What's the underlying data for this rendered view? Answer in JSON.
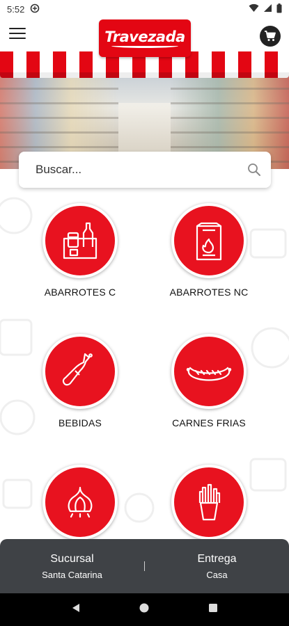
{
  "status_bar": {
    "time": "5:52"
  },
  "app": {
    "logo_text": "Travezada",
    "brand_color": "#e30613"
  },
  "search": {
    "placeholder": "Buscar..."
  },
  "categories": [
    {
      "label": "ABARROTES C",
      "icon": "canned-goods-icon"
    },
    {
      "label": "ABARROTES NC",
      "icon": "charcoal-bag-icon"
    },
    {
      "label": "BEBIDAS",
      "icon": "bottle-icon"
    },
    {
      "label": "CARNES FRIAS",
      "icon": "sausage-icon"
    },
    {
      "label": "",
      "icon": "garlic-icon"
    },
    {
      "label": "",
      "icon": "fries-icon"
    }
  ],
  "delivery": {
    "branch_title": "Sucursal",
    "branch_value": "Santa Catarina",
    "delivery_title": "Entrega",
    "delivery_value": "Casa",
    "bar_color": "#3f4246"
  }
}
